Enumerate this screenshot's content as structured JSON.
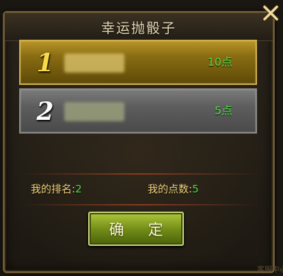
{
  "dialog": {
    "title": "幸运抛骰子",
    "confirm_label": "确 定"
  },
  "results": [
    {
      "rank": "1",
      "name_blurred": true,
      "points": "10点"
    },
    {
      "rank": "2",
      "name_blurred": true,
      "points": "5点"
    }
  ],
  "summary": {
    "rank_label": "我的排名:",
    "rank_value": "2",
    "points_label": "我的点数:",
    "points_value": "5"
  },
  "edge_text": "客服中心",
  "icons": {
    "close": "close-icon"
  },
  "colors": {
    "accent_green": "#4fe043",
    "label_gold": "#f2d37a",
    "gold_row": "#8a6d12",
    "silver_row": "#5d5d5d"
  }
}
